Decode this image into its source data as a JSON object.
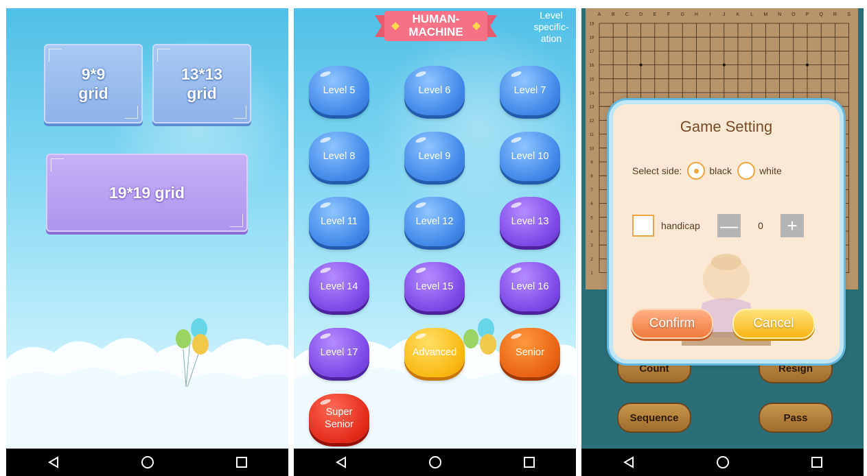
{
  "screen1": {
    "buttons": [
      {
        "label": "9*9\ngrid"
      },
      {
        "label": "13*13\ngrid"
      },
      {
        "label": "19*19 grid"
      }
    ]
  },
  "screen2": {
    "banner": "HUMAN-\nMACHINE",
    "level_spec": "Level specific-ation",
    "levels": [
      "Level 5",
      "Level 6",
      "Level 7",
      "Level 8",
      "Level 9",
      "Level 10",
      "Level 11",
      "Level 12",
      "Level 13",
      "Level 14",
      "Level 15",
      "Level 16",
      "Level 17",
      "Advanced",
      "Senior",
      "Super\nSenior"
    ]
  },
  "screen3": {
    "board": {
      "columns": [
        "A",
        "B",
        "C",
        "D",
        "E",
        "F",
        "G",
        "H",
        "I",
        "J",
        "K",
        "L",
        "M",
        "N",
        "O",
        "P",
        "Q",
        "R",
        "S"
      ],
      "rows": [
        "19",
        "18",
        "17",
        "16",
        "15",
        "14",
        "13",
        "12",
        "11",
        "10",
        "9",
        "8",
        "7",
        "6",
        "5",
        "4",
        "3",
        "2",
        "1"
      ]
    },
    "dialog": {
      "title": "Game Setting",
      "select_side_label": "Select side:",
      "black_label": "black",
      "white_label": "white",
      "selected_side": "black",
      "handicap_label": "handicap",
      "handicap_value": "0",
      "minus": "—",
      "plus": "+",
      "confirm": "Confirm",
      "cancel": "Cancel"
    },
    "actions": {
      "count": "Count",
      "resign": "Resign",
      "sequence": "Sequence",
      "pass": "Pass"
    }
  },
  "navbar": {
    "back_icon": "back-triangle-icon",
    "home_icon": "home-circle-icon",
    "recents_icon": "recents-square-icon"
  },
  "colors": {
    "sky_top": "#4fbfe6",
    "level_blue": "#3e86e8",
    "level_purple": "#7b46e6",
    "board": "#b7946a",
    "dialog_bg": "#fbe9d6"
  }
}
